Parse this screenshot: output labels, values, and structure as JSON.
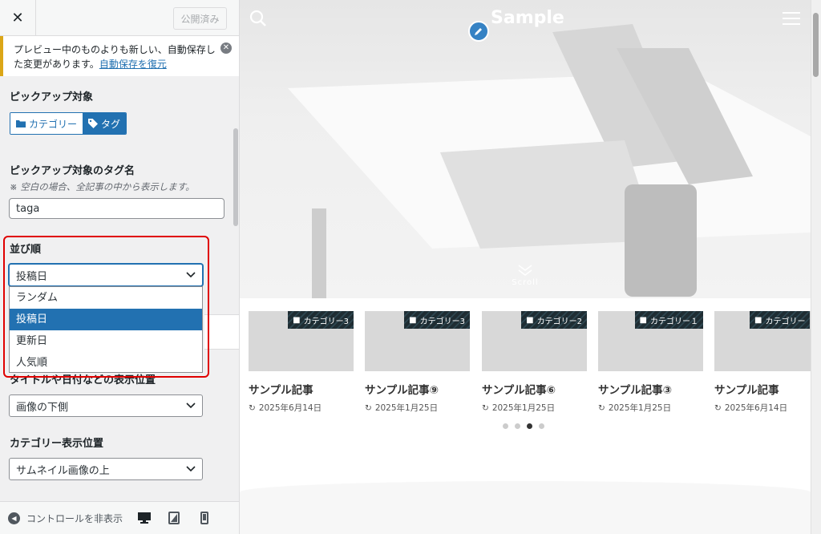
{
  "header": {
    "close_label": "✕",
    "publish_label": "公開済み"
  },
  "notice": {
    "text": "プレビュー中のものよりも新しい、自動保存した変更があります。",
    "link": "自動保存を復元",
    "dismiss": "✕"
  },
  "pickup_target": {
    "title": "ピックアップ対象",
    "options": [
      {
        "label": "カテゴリー",
        "icon": "folder-icon",
        "selected": false
      },
      {
        "label": "タグ",
        "icon": "tag-icon",
        "selected": true
      }
    ]
  },
  "tag_name": {
    "title": "ピックアップ対象のタグ名",
    "description": "※ 空白の場合、全記事の中から表示します。",
    "value": "taga"
  },
  "order": {
    "title": "並び順",
    "selected": "投稿日",
    "options": [
      "ランダム",
      "投稿日",
      "更新日",
      "人気順"
    ]
  },
  "title_position": {
    "title": "タイトルや日付などの表示位置",
    "selected": "画像の下側"
  },
  "category_position": {
    "title": "カテゴリー表示位置",
    "selected": "サムネイル画像の上"
  },
  "footer": {
    "collapse_label": "コントロールを非表示",
    "devices": [
      "desktop-icon",
      "tablet-icon",
      "mobile-icon"
    ]
  },
  "preview": {
    "site_title": "Sample",
    "scroll_label": "Scroll",
    "cards": [
      {
        "category": "カテゴリー3",
        "title": "サンプル記事",
        "date": "2025年6月14日"
      },
      {
        "category": "カテゴリー3",
        "title": "サンプル記事⑨",
        "date": "2025年1月25日"
      },
      {
        "category": "カテゴリー2",
        "title": "サンプル記事⑥",
        "date": "2025年1月25日"
      },
      {
        "category": "カテゴリー１",
        "title": "サンプル記事③",
        "date": "2025年1月25日"
      },
      {
        "category": "カテゴリー",
        "title": "サンプル記事",
        "date": "2025年6月14日"
      }
    ],
    "slider_dots": 4,
    "active_dot": 3
  },
  "colors": {
    "accent": "#2271b1",
    "highlight": "#e00000",
    "notice_border": "#dba617"
  }
}
